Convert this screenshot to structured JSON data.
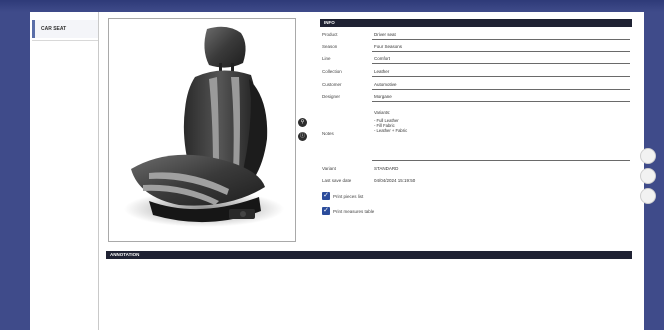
{
  "sidebar": {
    "items": [
      {
        "label": "CAR SEAT"
      }
    ]
  },
  "info": {
    "header": "INFO",
    "fields": [
      {
        "label": "Product",
        "value": "Driver seat"
      },
      {
        "label": "Season",
        "value": "Four Seasons"
      },
      {
        "label": "Line",
        "value": "Comfort"
      },
      {
        "label": "Collection",
        "value": "Leather"
      },
      {
        "label": "Customer",
        "value": "Automotive"
      },
      {
        "label": "Designer",
        "value": "Morgane"
      }
    ],
    "notes": {
      "label": "Notes",
      "title": "Variants:",
      "lines": [
        "- Full Leather",
        "- Fill Fabric",
        "- Leather + Fabric"
      ]
    },
    "variant": {
      "label": "Variant",
      "value": "STANDARD"
    },
    "last_save": {
      "label": "Last save date",
      "value": "04/04/2024 15:19:50"
    },
    "checkboxes": [
      {
        "label": "Print pieces list",
        "checked": true
      },
      {
        "label": "Print measures table",
        "checked": true
      }
    ]
  },
  "annotation": {
    "header": "ANNOTATION"
  },
  "icons": {
    "zoom": "zoom-icon",
    "info": "info-icon"
  },
  "colors": {
    "frame": "#3f4b8a",
    "header_bar": "#1f2233",
    "checkbox": "#2b4c9b"
  }
}
